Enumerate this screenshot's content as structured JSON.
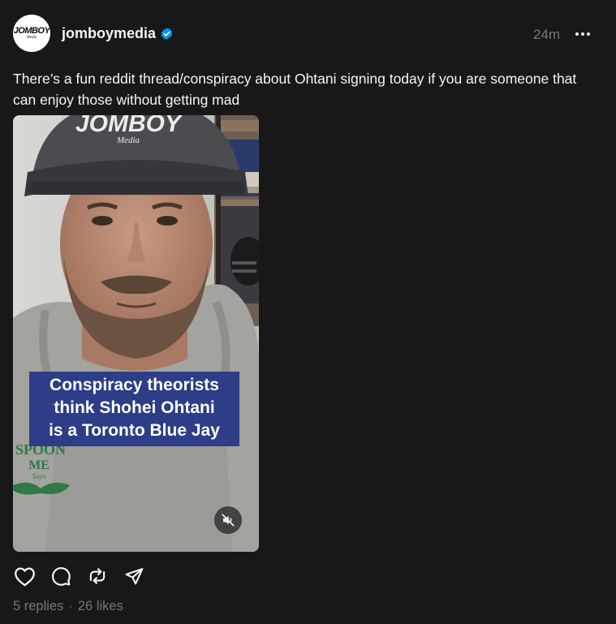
{
  "post": {
    "avatar": {
      "logo_main": "JOMBOY",
      "logo_sub": "Media",
      "icon": "avatar-logo"
    },
    "username": "jomboymedia",
    "verified_icon": "verified-badge-icon",
    "timestamp": "24m",
    "more_icon": "more-dots-icon",
    "caption": "There’s a fun reddit thread/conspiracy about Ohtani signing today if you are someone that can enjoy those without getting mad",
    "video": {
      "cap_text": "JOMBOY",
      "cap_subtext": "Media",
      "shirt_text_1": "SPOON",
      "shirt_text_2": "ME",
      "shirt_text_3": "Says",
      "overlay_lines": [
        "Conspiracy theorists",
        "think Shohei Ohtani",
        "is a Toronto Blue Jay"
      ],
      "overlay_color": "#2d3d87",
      "mute_icon": "muted-speaker-icon"
    },
    "actions": [
      {
        "icon": "heart-icon",
        "label": "Like"
      },
      {
        "icon": "comment-icon",
        "label": "Reply"
      },
      {
        "icon": "repost-icon",
        "label": "Repost"
      },
      {
        "icon": "share-icon",
        "label": "Share"
      }
    ],
    "stats": {
      "replies": "5 replies",
      "separator": "·",
      "likes": "26 likes"
    }
  },
  "colors": {
    "background": "#181818",
    "text": "#f3f5f7",
    "muted_text": "#777777",
    "verified": "#0095f6"
  }
}
